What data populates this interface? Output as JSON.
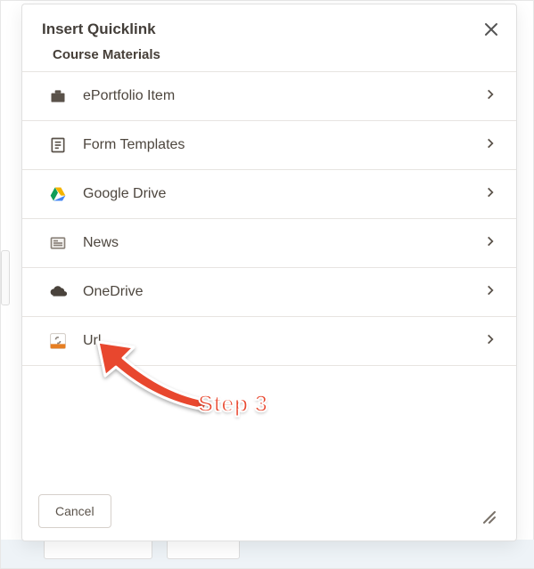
{
  "dialog": {
    "title": "Insert Quicklink",
    "section_label": "Course Materials",
    "items": [
      {
        "icon": "briefcase-icon",
        "label": "ePortfolio Item"
      },
      {
        "icon": "form-icon",
        "label": "Form Templates"
      },
      {
        "icon": "google-drive-icon",
        "label": "Google Drive"
      },
      {
        "icon": "news-icon",
        "label": "News"
      },
      {
        "icon": "onedrive-icon",
        "label": "OneDrive"
      },
      {
        "icon": "url-icon",
        "label": "Url"
      }
    ],
    "cancel_label": "Cancel"
  },
  "annotation": {
    "step_label": "Step 3"
  }
}
